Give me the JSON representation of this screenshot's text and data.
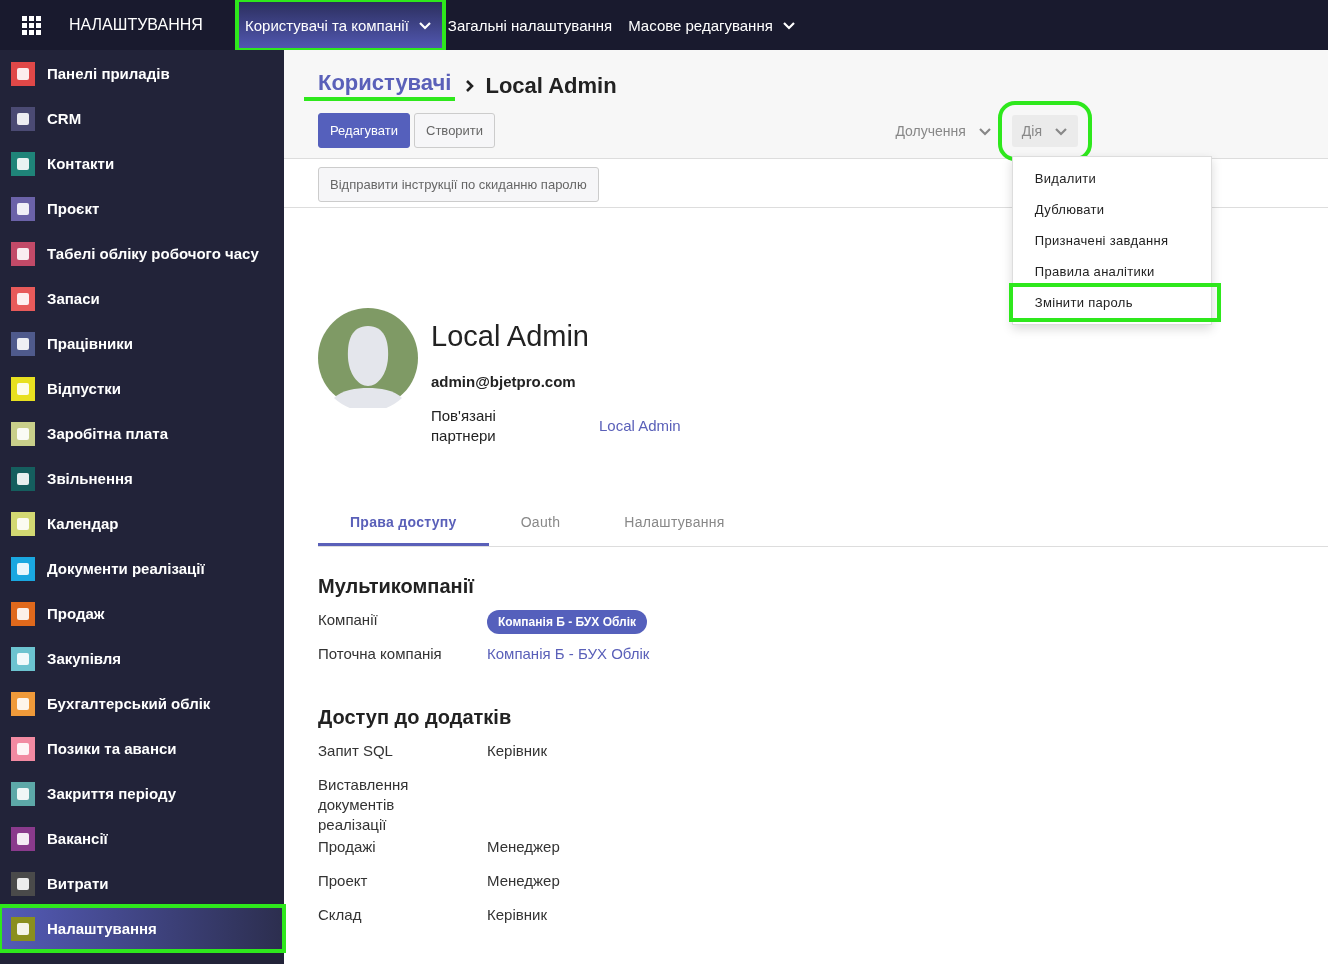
{
  "topbar": {
    "app_title": "НАЛАШТУВАННЯ",
    "menu": [
      {
        "label": "Користувачі та компанії",
        "selected": true,
        "highlighted": true,
        "caret": true
      },
      {
        "label": "Загальні налаштування",
        "selected": false,
        "highlighted": false,
        "caret": false
      },
      {
        "label": "Масове редагування",
        "selected": false,
        "highlighted": false,
        "caret": true
      }
    ]
  },
  "sidebar": {
    "items": [
      {
        "label": "Панелі приладів",
        "color": "#e04848",
        "selected": false,
        "highlighted": false
      },
      {
        "label": "CRM",
        "color": "#4b4a73",
        "selected": false,
        "highlighted": false
      },
      {
        "label": "Контакти",
        "color": "#1f8479",
        "selected": false,
        "highlighted": false
      },
      {
        "label": "Проєкт",
        "color": "#6b62a8",
        "selected": false,
        "highlighted": false
      },
      {
        "label": "Табелі обліку робочого часу",
        "color": "#c24a68",
        "selected": false,
        "highlighted": false
      },
      {
        "label": "Запаси",
        "color": "#e85a5a",
        "selected": false,
        "highlighted": false
      },
      {
        "label": "Працівники",
        "color": "#4f5a8c",
        "selected": false,
        "highlighted": false
      },
      {
        "label": "Відпустки",
        "color": "#e8e020",
        "selected": false,
        "highlighted": false
      },
      {
        "label": "Заробітна плата",
        "color": "#c9cf8a",
        "selected": false,
        "highlighted": false
      },
      {
        "label": "Звільнення",
        "color": "#155e5e",
        "selected": false,
        "highlighted": false
      },
      {
        "label": "Календар",
        "color": "#d2d872",
        "selected": false,
        "highlighted": false
      },
      {
        "label": "Документи реалізації",
        "color": "#1aa7e0",
        "selected": false,
        "highlighted": false
      },
      {
        "label": "Продаж",
        "color": "#e0691c",
        "selected": false,
        "highlighted": false
      },
      {
        "label": "Закупівля",
        "color": "#6cc3d0",
        "selected": false,
        "highlighted": false
      },
      {
        "label": "Бухгалтерський облік",
        "color": "#f09a3a",
        "selected": false,
        "highlighted": false
      },
      {
        "label": "Позики та аванси",
        "color": "#f28aa2",
        "selected": false,
        "highlighted": false
      },
      {
        "label": "Закриття періоду",
        "color": "#5da8a8",
        "selected": false,
        "highlighted": false
      },
      {
        "label": "Вакансії",
        "color": "#8a3a8c",
        "selected": false,
        "highlighted": false
      },
      {
        "label": "Витрати",
        "color": "#4a4a4a",
        "selected": false,
        "highlighted": false
      },
      {
        "label": "Налаштування",
        "color": "#8a8f1e",
        "selected": true,
        "highlighted": true
      }
    ]
  },
  "breadcrumb": [
    {
      "label": "Користувачі",
      "kind": "link",
      "highlighted": true
    },
    {
      "label": "Local Admin",
      "kind": "current",
      "highlighted": false
    }
  ],
  "buttons": [
    {
      "label": "Редагувати",
      "kind": "primary"
    },
    {
      "label": "Створити",
      "kind": "secondary"
    }
  ],
  "toolbar_dropdowns": [
    {
      "label": "Долучення",
      "open": false,
      "highlighted": false
    },
    {
      "label": "Дія",
      "open": true,
      "highlighted": true
    }
  ],
  "action_menu": [
    {
      "label": "Видалити",
      "highlighted": false
    },
    {
      "label": "Дублювати",
      "highlighted": false
    },
    {
      "label": "Призначені завдання",
      "highlighted": false
    },
    {
      "label": "Правила аналітики",
      "highlighted": false
    },
    {
      "label": "Змінити пароль",
      "highlighted": true
    }
  ],
  "sheet_buttons": [
    "Відправити інструкції по скиданню паролю"
  ],
  "user": {
    "name": "Local Admin",
    "email": "admin@bjetpro.com",
    "fields": [
      {
        "label": "Пов'язані партнери",
        "value": "Local Admin",
        "kind": "link"
      }
    ]
  },
  "tabs": [
    {
      "label": "Права доступу",
      "selected": true
    },
    {
      "label": "Oauth",
      "selected": false
    },
    {
      "label": "Налаштування",
      "selected": false
    }
  ],
  "sections": [
    {
      "title": "Мультикомпанії",
      "fields": [
        {
          "label": "Компанії",
          "value": "Компанія Б - БУХ Облік",
          "kind": "tag"
        },
        {
          "label": "Поточна компанія",
          "value": "Компанія Б - БУХ Облік",
          "kind": "link"
        }
      ]
    },
    {
      "title": "Доступ до додатків",
      "fields": [
        {
          "label": "Запит SQL",
          "value": "Керівник",
          "kind": "text"
        },
        {
          "label": "Виставлення документів реалізації"
        },
        {
          "label": "Продажі",
          "value": "Менеджер",
          "kind": "text"
        },
        {
          "label": "Проект",
          "value": "Менеджер",
          "kind": "text"
        },
        {
          "label": "Склад",
          "value": "Керівник",
          "kind": "text"
        }
      ]
    }
  ]
}
